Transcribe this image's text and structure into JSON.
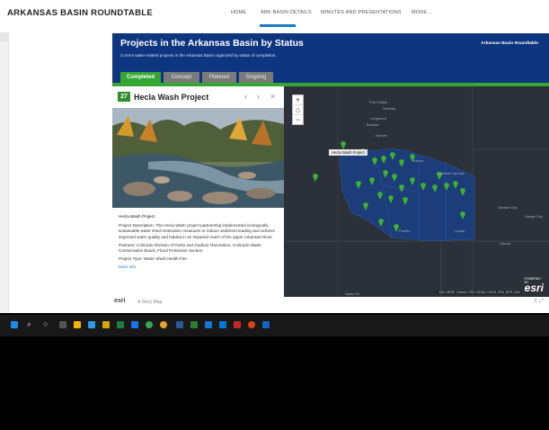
{
  "nav": {
    "brand": "ARKANSAS BASIN ROUNDTABLE",
    "items": [
      "HOME",
      "ARK BASIN DETAILS",
      "MINUTES AND PRESENTATIONS",
      "MORE..."
    ]
  },
  "story": {
    "title": "Projects in the Arkansas Basin by Status",
    "subtitle": "Current water-related projects in the Arkansas Basin organized by status of completion.",
    "header_right": "Arkansas Basin Roundtable"
  },
  "tabs": [
    "Completed",
    "Concept",
    "Planned",
    "Ongoing"
  ],
  "panel": {
    "number": "27",
    "title": "Hecla Wash Project",
    "nav_prev": "‹",
    "nav_next": "›",
    "nav_close": "×",
    "heading": "Hecla Wash Project",
    "description": "Project Description: The Hecla Wash project partnership implemented ecologically sustainable water shed restoration measures to reduce sediment loading and achieve improved water quality and habitat in an impaired reach of the upper Arkansas River.",
    "partners": "Partners: Colorado Division of Parks and Outdoor Recreation, Colorado Water Conservation Board, Flood Protection Section.",
    "type": "Project Type: Water Shed Health Fire",
    "more": "More info"
  },
  "footer": {
    "esri": "esri",
    "storymap": "A Story Map"
  },
  "map": {
    "zoom_in": "+",
    "home": "⌂",
    "zoom_out": "−",
    "tooltip": "Hecla Wash Project",
    "labels": [
      "Fort Collins",
      "Greeley",
      "Longmont",
      "Boulder",
      "Denver",
      "Aurora",
      "Colorado Springs",
      "Pueblo",
      "Lamar",
      "Santa Fe",
      "Garden City",
      "Dodge City",
      "Liberal"
    ],
    "attribution": "Esri, HERE, Garmin, FAO, NOAA, USGS, EPA, NPS | Esri",
    "watermark": "esri",
    "powered": "POWERED BY"
  },
  "colors": {
    "accent": "#35a534",
    "header_bg": "#0d3580",
    "nav_underline": "#1b79c9"
  }
}
